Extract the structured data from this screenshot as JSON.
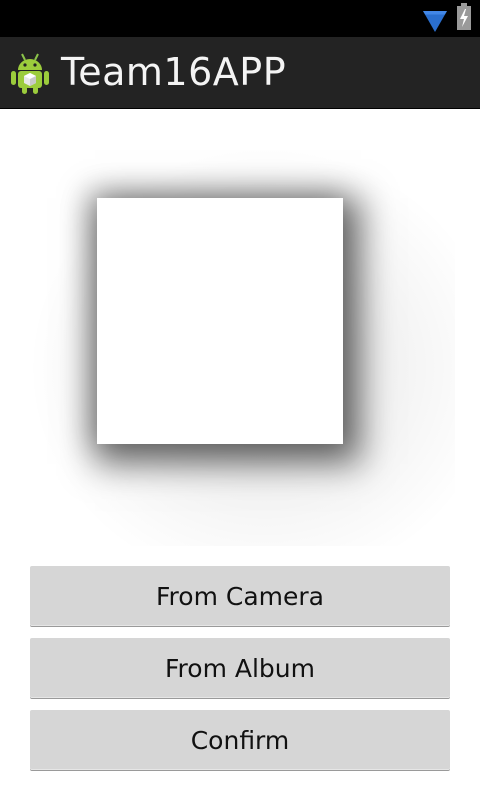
{
  "status_bar": {
    "icons": [
      "wifi-icon",
      "battery-charging-icon"
    ],
    "wifi_color": "#2a6fcf"
  },
  "action_bar": {
    "app_icon": "android-icon",
    "title": "Team16APP",
    "background": "#232323"
  },
  "preview": {
    "image": "empty-image-placeholder"
  },
  "buttons": {
    "from_camera": "From Camera",
    "from_album": "From Album",
    "confirm": "Confirm"
  }
}
